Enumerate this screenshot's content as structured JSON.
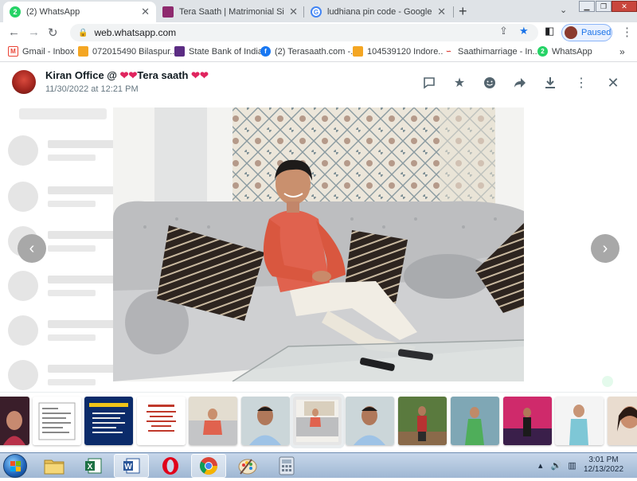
{
  "browser": {
    "tabs": [
      {
        "title": "(2) WhatsApp",
        "badge": "2"
      },
      {
        "title": "Tera Saath | Matrimonial Site | Be"
      },
      {
        "title": "ludhiana pin code - Google Searc"
      }
    ],
    "url": "web.whatsapp.com",
    "profile_label": "Paused"
  },
  "bookmarks": [
    {
      "label": "Gmail - Inbox"
    },
    {
      "label": "072015490 Bilaspur..."
    },
    {
      "label": "State Bank of India"
    },
    {
      "label": "(2) Terasaath.com -..."
    },
    {
      "label": "104539120 Indore..."
    },
    {
      "label": "Saathimarriage - In..."
    },
    {
      "label": "WhatsApp",
      "badge": "2"
    }
  ],
  "viewer": {
    "sender_name": "Kiran Office @ ",
    "sender_suffix": "Tera saath ",
    "hearts": "❤❤",
    "timestamp": "11/30/2022 at 12:21 PM"
  },
  "taskbar": {
    "time": "3:01 PM",
    "date": "12/13/2022",
    "excel_letter": "X",
    "word_letter": "W"
  },
  "colors": {
    "whatsapp_green": "#25d366",
    "accent_blue": "#1a73e8"
  }
}
